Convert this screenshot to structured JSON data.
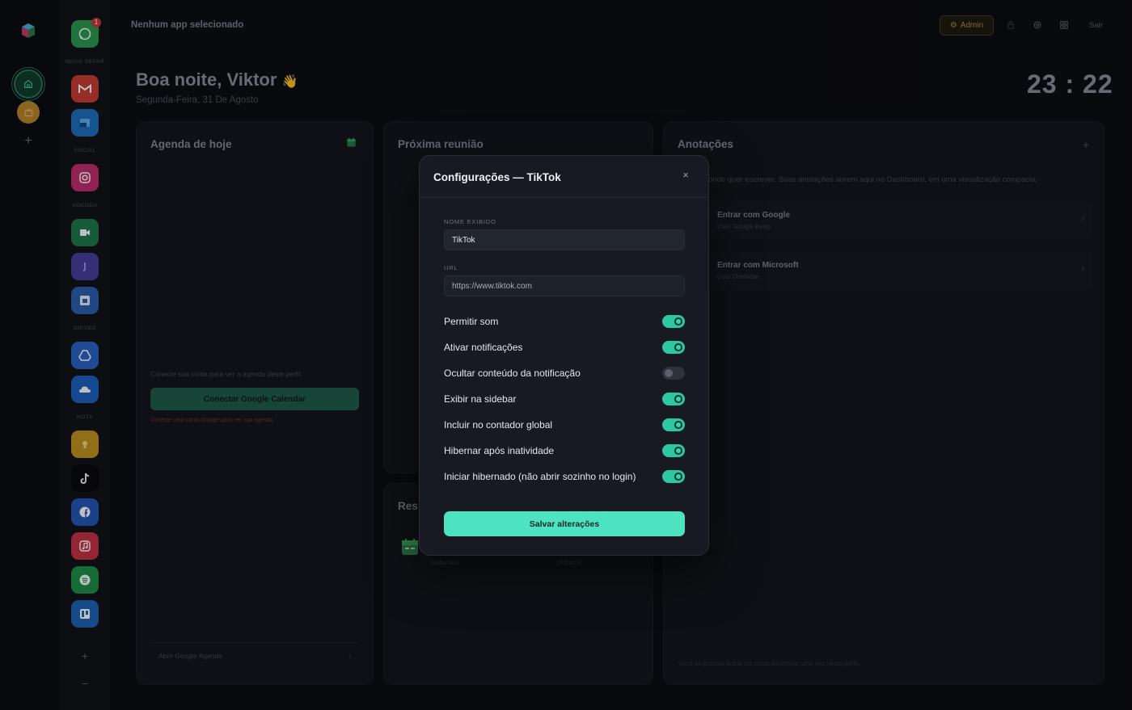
{
  "topbar": {
    "title": "Nenhum app selecionado",
    "admin_label": "Admin",
    "logout_label": "Sair"
  },
  "greeting": {
    "text": "Boa noite, Viktor",
    "wave": "👋",
    "date": "Segunda-Feira, 31 De Agosto"
  },
  "clock": "23 : 22",
  "sidebar": {
    "sections": [
      "NOVO SEPAR",
      "SOCIAL",
      "AGENDA",
      "DRIVES",
      "NOTA"
    ],
    "whatsapp_badge": "1",
    "add": "+",
    "remove": "−"
  },
  "agenda": {
    "title": "Agenda de hoje",
    "hint": "Conecte sua conta para ver a agenda deste perfil.",
    "connect_label": "Conectar Google Calendar",
    "error": "Conecte uma conta Google para ver sua agenda",
    "footer": "Abrir Google Agenda"
  },
  "meeting": {
    "title": "Próxima reunião"
  },
  "resumo": {
    "title": "Res",
    "label1": "restantes",
    "label2": "restante"
  },
  "notes": {
    "title": "Anotações",
    "desc": "onde quer escrever. Suas anotações abrem aqui no Dashboard, em uma visualização compacta.",
    "options": [
      {
        "title": "Entrar com Google",
        "sub": "Usar Google Keep"
      },
      {
        "title": "Entrar com Microsoft",
        "sub": "Usar OneNote"
      }
    ],
    "footer": "Você só precisa entrar na conta escolhida uma vez neste perfil."
  },
  "modal": {
    "title": "Configurações — TikTok",
    "close": "×",
    "name_label": "NOME EXIBIDO",
    "name_value": "TikTok",
    "url_label": "URL",
    "url_value": "https://www.tiktok.com",
    "toggles": [
      {
        "label": "Permitir som",
        "on": true
      },
      {
        "label": "Ativar notificações",
        "on": true
      },
      {
        "label": "Ocultar conteúdo da notificação",
        "on": false
      },
      {
        "label": "Exibir na sidebar",
        "on": true
      },
      {
        "label": "Incluir no contador global",
        "on": true
      },
      {
        "label": "Hibernar após inatividade",
        "on": true
      },
      {
        "label": "Iniciar hibernado (não abrir sozinho no login)",
        "on": true
      }
    ],
    "save_label": "Salvar alterações"
  },
  "icons": {
    "apps": [
      "whatsapp-icon",
      "gmail-icon",
      "outlook-icon",
      "instagram-icon",
      "google-meet-icon",
      "teams-icon",
      "calendar-icon",
      "google-drive-icon",
      "onedrive-icon",
      "google-keep-icon",
      "tiktok-icon",
      "facebook-icon",
      "apple-music-icon",
      "spotify-icon",
      "trello-icon"
    ]
  },
  "colors": {
    "accent": "#4ee3c0",
    "toggle_on": "#2fc7a1",
    "admin": "#b48a34"
  }
}
